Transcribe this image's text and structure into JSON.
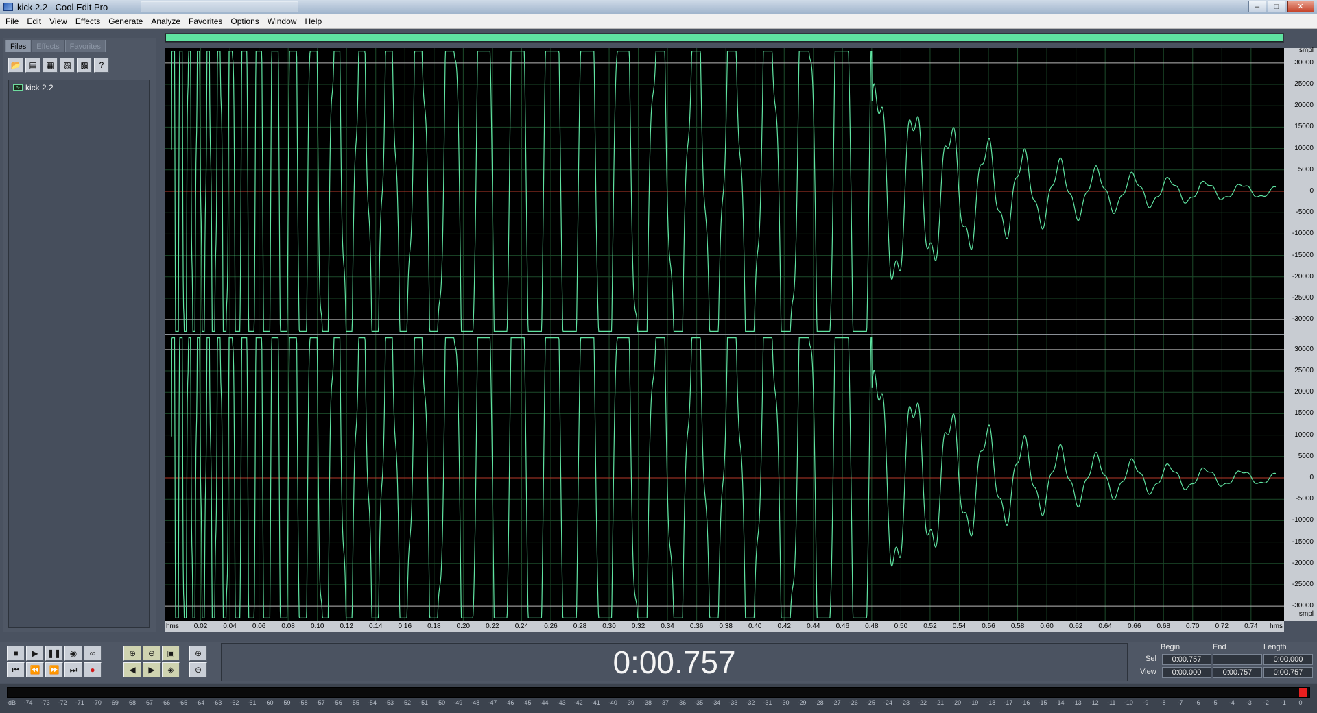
{
  "window": {
    "title": "kick 2.2 - Cool Edit Pro",
    "controls": [
      "minimize",
      "maximize",
      "close"
    ]
  },
  "menu": [
    "File",
    "Edit",
    "View",
    "Effects",
    "Generate",
    "Analyze",
    "Favorites",
    "Options",
    "Window",
    "Help"
  ],
  "left_panel": {
    "tabs": [
      {
        "label": "Files",
        "active": true
      },
      {
        "label": "Effects",
        "active": false
      },
      {
        "label": "Favorites",
        "active": false
      }
    ],
    "toolbar_icons": [
      "open-folder-icon",
      "import-icon",
      "close-file-icon",
      "close-all-icon",
      "insert-multitrack-icon",
      "help-icon"
    ],
    "files": [
      {
        "label": "kick 2.2"
      }
    ]
  },
  "waveform": {
    "amplitude_unit": "smpl",
    "time_unit": "hms",
    "channels": 2,
    "amplitude_labels": [
      "30000",
      "25000",
      "20000",
      "15000",
      "10000",
      "5000",
      "0",
      "-5000",
      "-10000",
      "-15000",
      "-20000",
      "-25000",
      "-30000"
    ],
    "time_labels": [
      "0.02",
      "0.04",
      "0.06",
      "0.08",
      "0.10",
      "0.12",
      "0.14",
      "0.16",
      "0.18",
      "0.20",
      "0.22",
      "0.24",
      "0.26",
      "0.28",
      "0.30",
      "0.32",
      "0.34",
      "0.36",
      "0.38",
      "0.40",
      "0.42",
      "0.44",
      "0.46",
      "0.48",
      "0.50",
      "0.52",
      "0.54",
      "0.56",
      "0.58",
      "0.60",
      "0.62",
      "0.64",
      "0.66",
      "0.68",
      "0.70",
      "0.72",
      "0.74"
    ],
    "time_range": [
      0,
      0.757
    ],
    "clip_until": 0.48,
    "wave_color": "#5fe3a1",
    "centerline_color": "#b83a2a",
    "grid_color": "#1c4a2a"
  },
  "transport": {
    "row1": [
      "stop-icon",
      "play-icon",
      "pause-icon",
      "play-to-end-icon",
      "loop-icon"
    ],
    "row2": [
      "go-to-start-icon",
      "rewind-icon",
      "fast-forward-icon",
      "go-to-end-icon",
      "record-icon"
    ],
    "zoom_row1": [
      "zoom-in-horizontal-icon",
      "zoom-out-horizontal-icon",
      "zoom-full-icon"
    ],
    "zoom_row2": [
      "zoom-in-left-icon",
      "zoom-in-right-icon",
      "zoom-selection-icon"
    ],
    "vzoom": [
      "zoom-in-vertical-icon",
      "zoom-out-vertical-icon"
    ]
  },
  "time_display": "0:00.757",
  "selection": {
    "headers": [
      "Begin",
      "End",
      "Length"
    ],
    "sel": {
      "label": "Sel",
      "begin": "0:00.757",
      "end": "",
      "length": "0:00.000"
    },
    "view": {
      "label": "View",
      "begin": "0:00.000",
      "end": "0:00.757",
      "length": "0:00.757"
    }
  },
  "level_meter": {
    "ticks": [
      "-dB",
      "-74",
      "-73",
      "-72",
      "-71",
      "-70",
      "-69",
      "-68",
      "-67",
      "-66",
      "-65",
      "-64",
      "-63",
      "-62",
      "-61",
      "-60",
      "-59",
      "-58",
      "-57",
      "-56",
      "-55",
      "-54",
      "-53",
      "-52",
      "-51",
      "-50",
      "-49",
      "-48",
      "-47",
      "-46",
      "-45",
      "-44",
      "-43",
      "-42",
      "-41",
      "-40",
      "-39",
      "-38",
      "-37",
      "-36",
      "-35",
      "-34",
      "-33",
      "-32",
      "-31",
      "-30",
      "-29",
      "-28",
      "-27",
      "-26",
      "-25",
      "-24",
      "-23",
      "-22",
      "-21",
      "-20",
      "-19",
      "-18",
      "-17",
      "-16",
      "-15",
      "-14",
      "-13",
      "-12",
      "-11",
      "-10",
      "-9",
      "-8",
      "-7",
      "-6",
      "-5",
      "-4",
      "-3",
      "-2",
      "-1",
      "0"
    ],
    "clip_color": "#e81f1f"
  }
}
